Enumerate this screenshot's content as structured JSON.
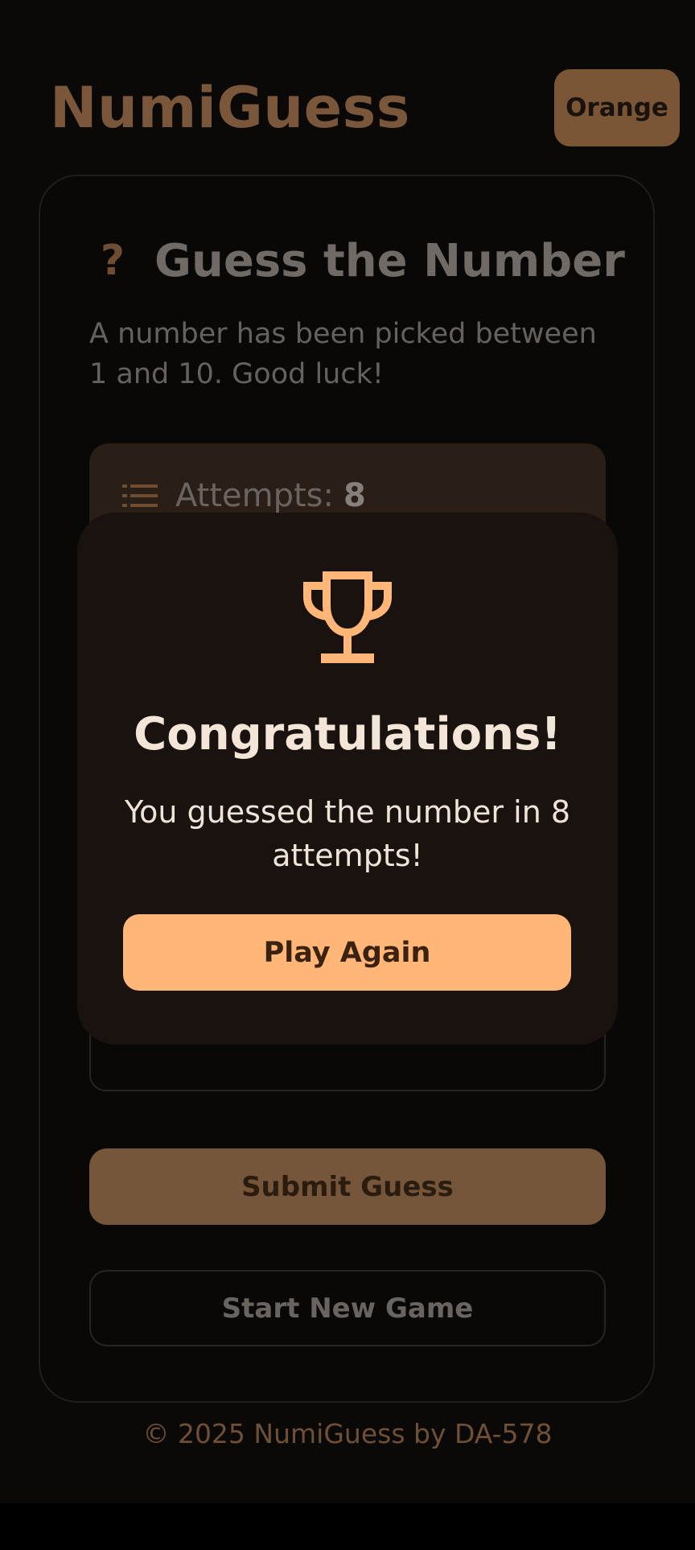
{
  "header": {
    "brand": "NumiGuess",
    "theme_button_label": "Orange"
  },
  "game": {
    "title_icon": "question-mark-icon",
    "title": "Guess the Number",
    "description": "A number has been picked between 1 and 10. Good luck!",
    "attempts_label": "Attempts:",
    "attempts_value": "8",
    "guess_input_value": "",
    "submit_label": "Submit Guess",
    "new_game_label": "Start New Game"
  },
  "modal": {
    "icon": "trophy-icon",
    "title": "Congratulations!",
    "message": "You guessed the number in 8 attempts!",
    "play_again_label": "Play Again"
  },
  "footer": {
    "text": "© 2025 NumiGuess by DA-578"
  },
  "colors": {
    "accent": "#ffb676",
    "background": "#0b0908",
    "modal_background": "#19120e"
  }
}
